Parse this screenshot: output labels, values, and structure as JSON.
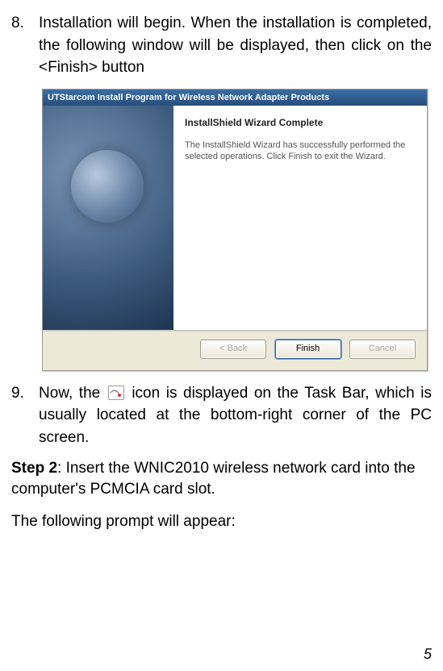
{
  "steps": {
    "s8": {
      "num": "8.",
      "text": "Installation will begin. When the installation is completed, the following window will be displayed, then click on the <Finish> button"
    },
    "s9": {
      "num": "9.",
      "pre": "Now, the ",
      "post": " icon is displayed on the Task Bar, which is usually located at the bottom-right corner of the PC screen."
    }
  },
  "wizard": {
    "title": "UTStarcom Install Program for Wireless Network Adapter Products",
    "heading": "InstallShield Wizard Complete",
    "body": "The InstallShield Wizard has successfully performed the selected operations.   Click Finish to exit the Wizard.",
    "buttons": {
      "back": "< Back",
      "finish": "Finish",
      "cancel": "Cancel"
    }
  },
  "step2_label": "Step 2",
  "step2_rest": ": Insert the WNIC2010 wireless network card into the computer's PCMCIA card slot.",
  "prompt_line": "The following prompt will appear:",
  "page_number": "5"
}
